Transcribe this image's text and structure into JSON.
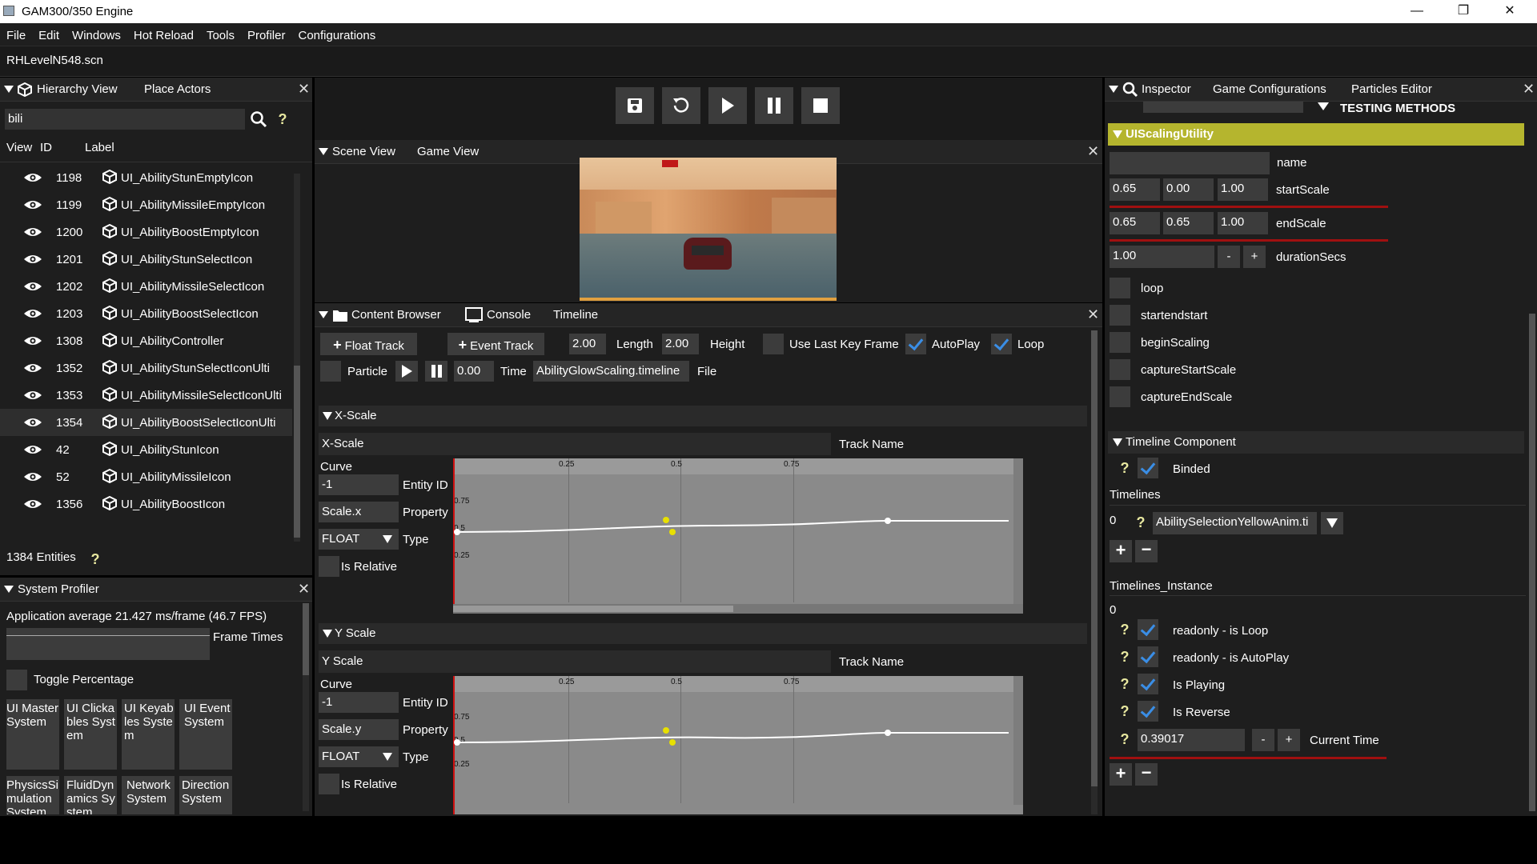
{
  "window": {
    "title": "GAM300/350 Engine",
    "minimize": "—",
    "maximize": "❐",
    "close": "✕"
  },
  "menu": [
    "File",
    "Edit",
    "Windows",
    "Hot Reload",
    "Tools",
    "Profiler",
    "Configurations"
  ],
  "scene_file": "RHLevelN548.scn",
  "hierarchy": {
    "tabs": [
      "Hierarchy View",
      "Place Actors"
    ],
    "search_value": "bili",
    "col_view": "View",
    "col_id": "ID",
    "col_label": "Label",
    "rows": [
      {
        "id": "1198",
        "label": "UI_AbilityStunEmptyIcon"
      },
      {
        "id": "1199",
        "label": "UI_AbilityMissileEmptyIcon"
      },
      {
        "id": "1200",
        "label": "UI_AbilityBoostEmptyIcon"
      },
      {
        "id": "1201",
        "label": "UI_AbilityStunSelectIcon"
      },
      {
        "id": "1202",
        "label": "UI_AbilityMissileSelectIcon"
      },
      {
        "id": "1203",
        "label": "UI_AbilityBoostSelectIcon"
      },
      {
        "id": "1308",
        "label": "UI_AbilityController"
      },
      {
        "id": "1352",
        "label": "UI_AbilityStunSelectIconUlti"
      },
      {
        "id": "1353",
        "label": "UI_AbilityMissileSelectIconUlti"
      },
      {
        "id": "1354",
        "label": "UI_AbilityBoostSelectIconUlti"
      },
      {
        "id": "42",
        "label": "UI_AbilityStunIcon"
      },
      {
        "id": "52",
        "label": "UI_AbilityMissileIcon"
      },
      {
        "id": "1356",
        "label": "UI_AbilityBoostIcon"
      }
    ],
    "entities": "1384 Entities"
  },
  "profiler": {
    "title": "System Profiler",
    "average": "Application average 21.427 ms/frame (46.7 FPS)",
    "frame_times": "Frame Times",
    "toggle": "Toggle Percentage",
    "systems": [
      "UI Master System",
      "UI Clickables System",
      "UI Keyables System",
      "UI Event System",
      "PhysicsSimulation System",
      "FluidDynamics System",
      "Network System",
      "Direction System"
    ]
  },
  "scene": {
    "tabs": [
      "Scene View",
      "Game View"
    ]
  },
  "content": {
    "tabs": [
      "Content Browser",
      "Console",
      "Timeline"
    ],
    "float_track": "Float Track",
    "event_track": "Event Track",
    "length_value": "2.00",
    "length_label": "Length",
    "height_value": "2.00",
    "height_label": "Height",
    "use_last_key": "Use Last Key Frame",
    "autoplay": "AutoPlay",
    "loop": "Loop",
    "particle": "Particle",
    "time_value": "0.00",
    "time_label": "Time",
    "file_value": "AbilityGlowScaling.timeline",
    "file_label": "File",
    "tracks": [
      {
        "header": "X-Scale",
        "name_value": "X-Scale",
        "name_label": "Track Name",
        "curve": "Curve",
        "entity_value": "-1",
        "entity_label": "Entity ID",
        "property_value": "Scale.x",
        "property_label": "Property",
        "type_value": "FLOAT",
        "type_label": "Type",
        "relative": "Is Relative"
      },
      {
        "header": "Y Scale",
        "name_value": "Y Scale",
        "name_label": "Track Name",
        "curve": "Curve",
        "entity_value": "-1",
        "entity_label": "Entity ID",
        "property_value": "Scale.y",
        "property_label": "Property",
        "type_value": "FLOAT",
        "type_label": "Type",
        "relative": "Is Relative"
      }
    ],
    "ticks_x": [
      "0.25",
      "0.5",
      "0.75"
    ],
    "ticks_y": [
      "0.75",
      "0.5",
      "0.25"
    ]
  },
  "inspector": {
    "tabs": [
      "Inspector",
      "Game Configurations",
      "Particles Editor"
    ],
    "testing": "TESTING METHODS",
    "component": "UIScalingUtility",
    "name_label": "name",
    "start_scale": [
      "0.65",
      "0.00",
      "1.00"
    ],
    "start_label": "startScale",
    "end_scale": [
      "0.65",
      "0.65",
      "1.00"
    ],
    "end_label": "endScale",
    "duration_value": "1.00",
    "duration_label": "durationSecs",
    "minus": "-",
    "plus": "+",
    "flags": [
      "loop",
      "startendstart",
      "beginScaling",
      "captureStartScale",
      "captureEndScale"
    ],
    "timeline_component": "Timeline Component",
    "binded": "Binded",
    "timelines": "Timelines",
    "timeline_index": "0",
    "timeline_value": "AbilitySelectionYellowAnim.ti",
    "timelines_instance": "Timelines_Instance",
    "instance_index": "0",
    "instance_flags": [
      "readonly - is Loop",
      "readonly - is AutoPlay",
      "Is Playing",
      "Is Reverse"
    ],
    "current_time_value": "0.39017",
    "current_time_label": "Current Time"
  }
}
